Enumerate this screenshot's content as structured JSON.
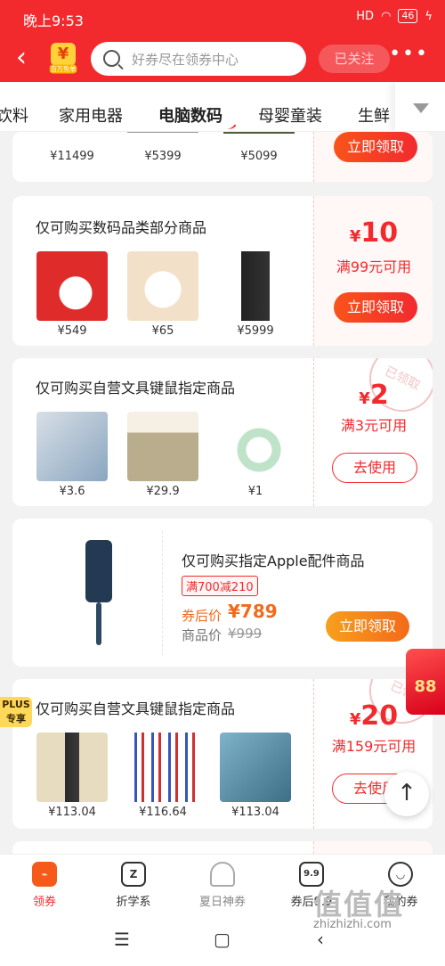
{
  "status_bar": {
    "time": "晚上9:53",
    "signal": "HD",
    "battery": "46"
  },
  "header": {
    "logo_text": "百万免单",
    "search_placeholder": "好券尽在领券中心",
    "follow_label": "已关注",
    "more": "•••"
  },
  "categories": [
    {
      "label": "饮料"
    },
    {
      "label": "家用电器"
    },
    {
      "label": "电脑数码",
      "active": true
    },
    {
      "label": "母婴童装"
    },
    {
      "label": "生鲜"
    }
  ],
  "cards": [
    {
      "products": [
        {
          "price": "¥11499"
        },
        {
          "price": "¥5399"
        },
        {
          "price": "¥5099"
        }
      ],
      "button": "立即领取"
    },
    {
      "title": "仅可购买数码品类部分商品",
      "products": [
        {
          "price": "¥549"
        },
        {
          "price": "¥65"
        },
        {
          "price": "¥5999"
        }
      ],
      "currency": "¥",
      "amount": "10",
      "condition": "满99元可用",
      "button": "立即领取"
    },
    {
      "title": "仅可购买自营文具键鼠指定商品",
      "products": [
        {
          "price": "¥3.6"
        },
        {
          "price": "¥29.9"
        },
        {
          "price": "¥1"
        }
      ],
      "currency": "¥",
      "amount": "2",
      "condition": "满3元可用",
      "button": "去使用",
      "stamp": "已领取"
    },
    {
      "title": "仅可购买指定Apple配件商品",
      "tag": "满700减210",
      "after_label": "券后价",
      "after_price": "¥789",
      "orig_label": "商品价",
      "orig_price": "¥999",
      "button": "立即领取"
    },
    {
      "badge": "PLUS专享",
      "title": "仅可购买自营文具键鼠指定商品",
      "products": [
        {
          "price": "¥113.04"
        },
        {
          "price": "¥116.64"
        },
        {
          "price": "¥113.04"
        }
      ],
      "currency": "¥",
      "amount": "20",
      "condition": "满159元可用",
      "button": "去使用",
      "stamp": "已领"
    }
  ],
  "redpack_text": "88",
  "tabbar": [
    {
      "label": "领券",
      "icon": "coupon-icon",
      "active": true
    },
    {
      "label": "折学系",
      "icon": "z-icon"
    },
    {
      "label": "夏日神券",
      "icon": "cake-icon"
    },
    {
      "label": "券后9.9",
      "icon": "nine-icon",
      "icon_text": "9.9"
    },
    {
      "label": "我的券",
      "icon": "smile-icon"
    }
  ],
  "watermark": {
    "big": "值值值",
    "small": "zhizhizhi.com"
  }
}
